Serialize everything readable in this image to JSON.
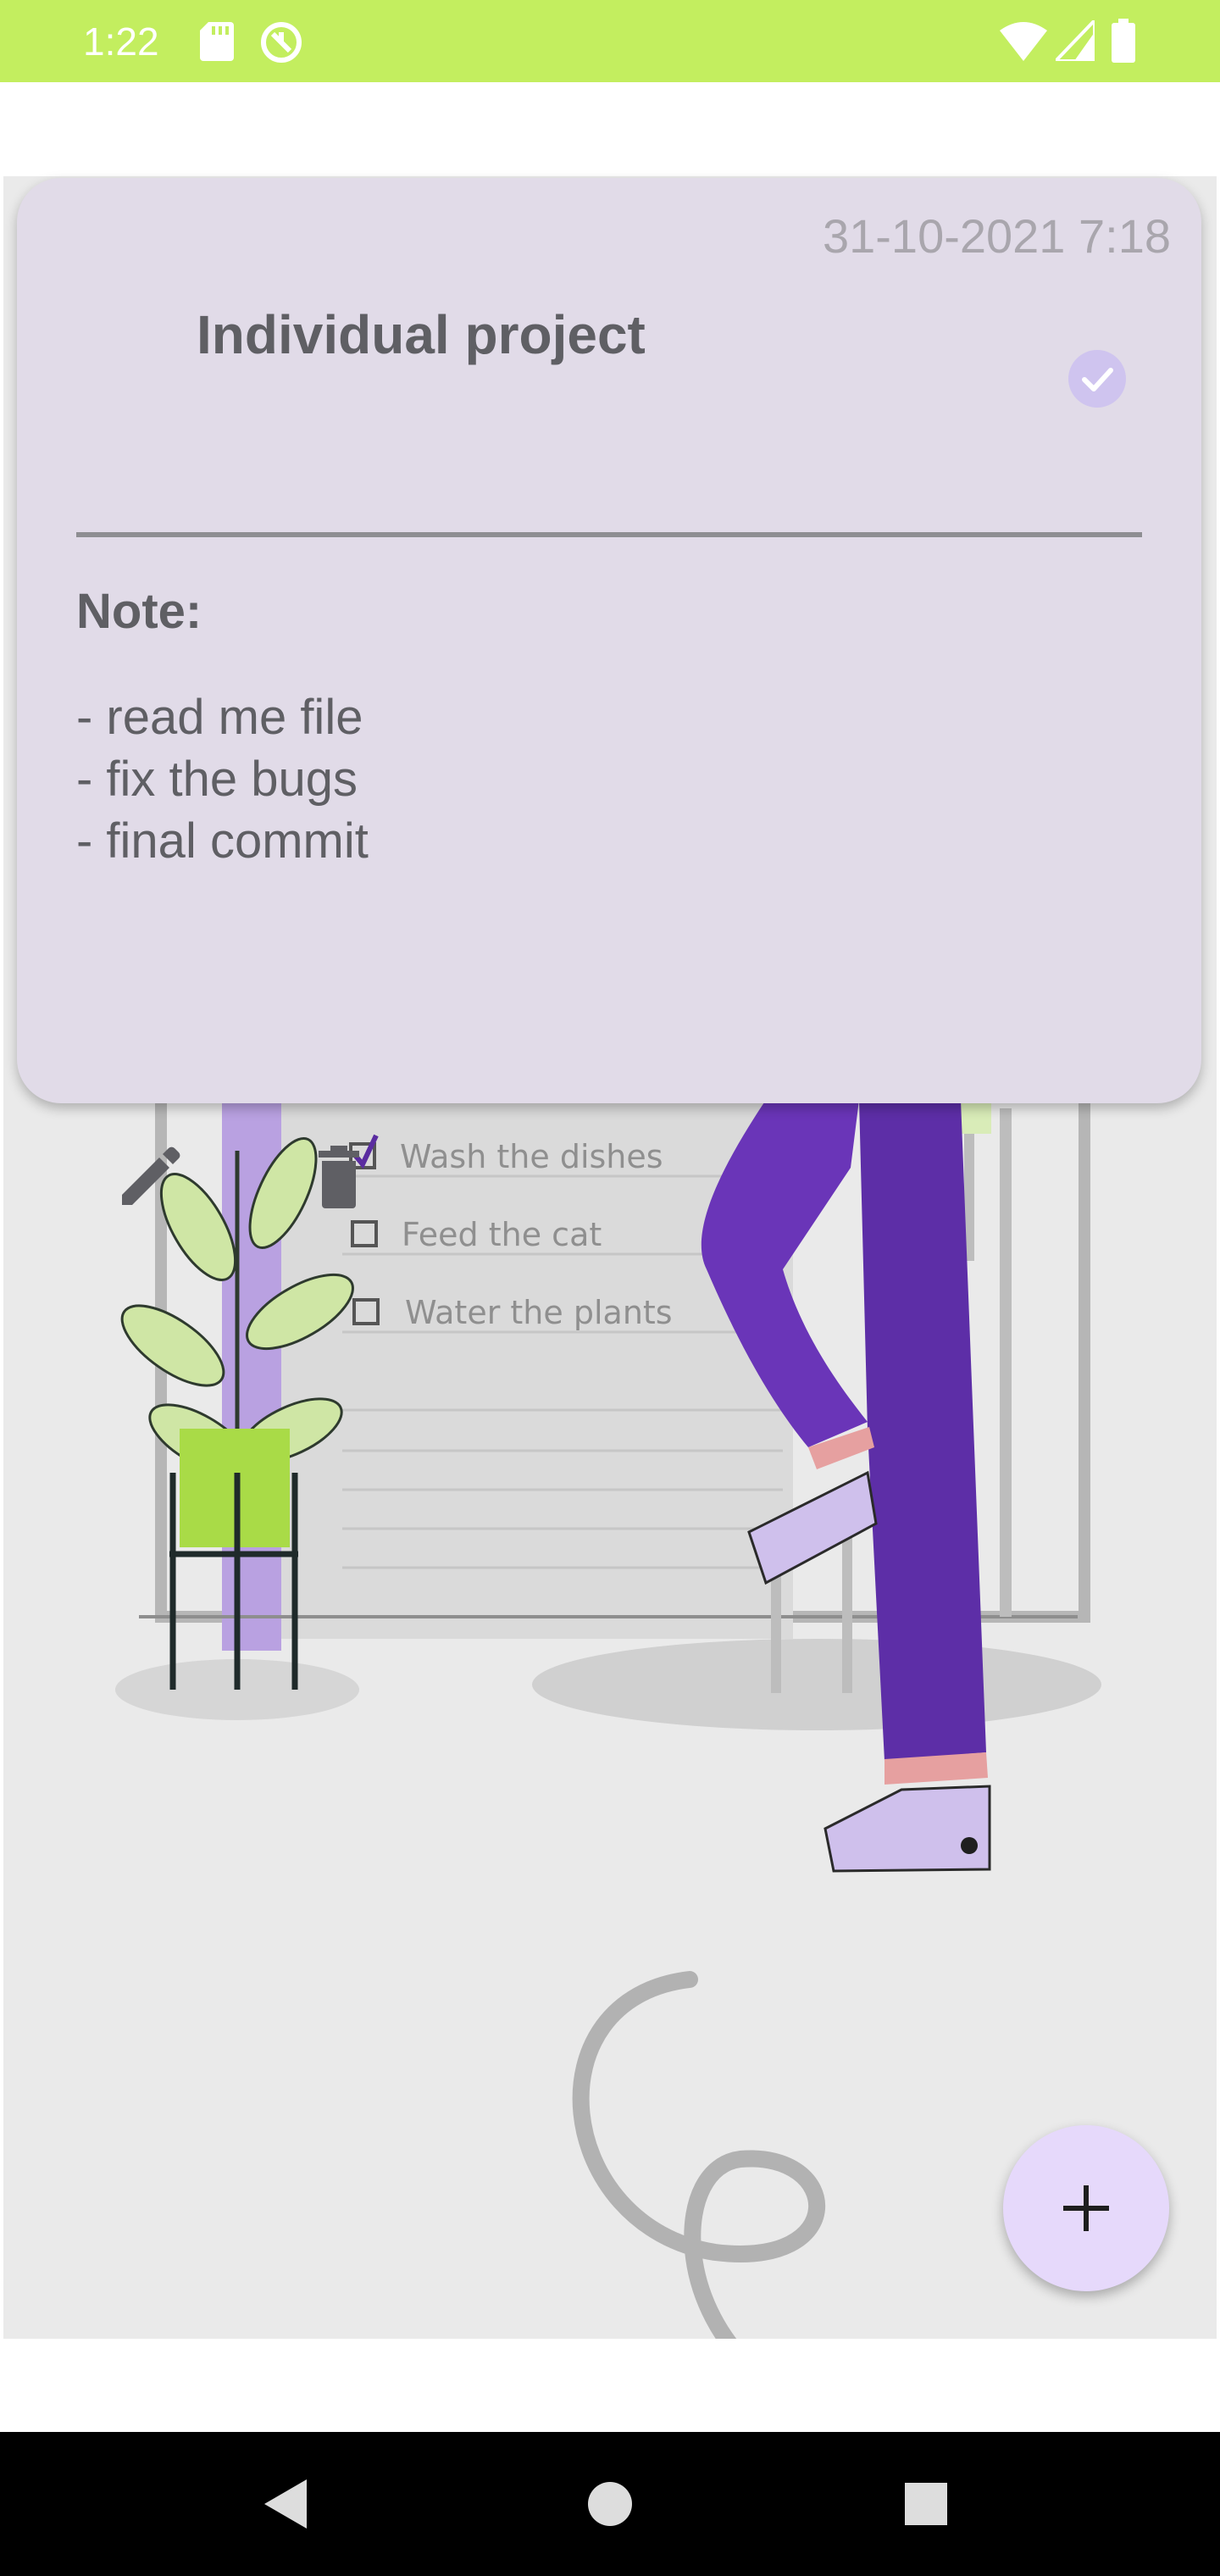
{
  "status_bar": {
    "time": "1:22",
    "icons": [
      "sd-card-icon",
      "sync-icon",
      "wifi-icon",
      "signal-icon",
      "battery-icon"
    ],
    "background": "#c3ee5f"
  },
  "note": {
    "date": "31-10-2021 7:18",
    "title": "Individual project",
    "note_label": "Note:",
    "body": "- read me file\n- fix the bugs\n- final commit",
    "card_color": "#e1dbe8",
    "completed": true
  },
  "illustration": {
    "checklist": [
      {
        "text": "Wash the dishes",
        "checked": true
      },
      {
        "text": "Feed the cat",
        "checked": false
      },
      {
        "text": "Water the plants",
        "checked": false
      }
    ]
  },
  "fab": {
    "icon": "plus-icon"
  },
  "nav": {
    "icons": [
      "back-icon",
      "home-icon",
      "recents-icon"
    ]
  }
}
